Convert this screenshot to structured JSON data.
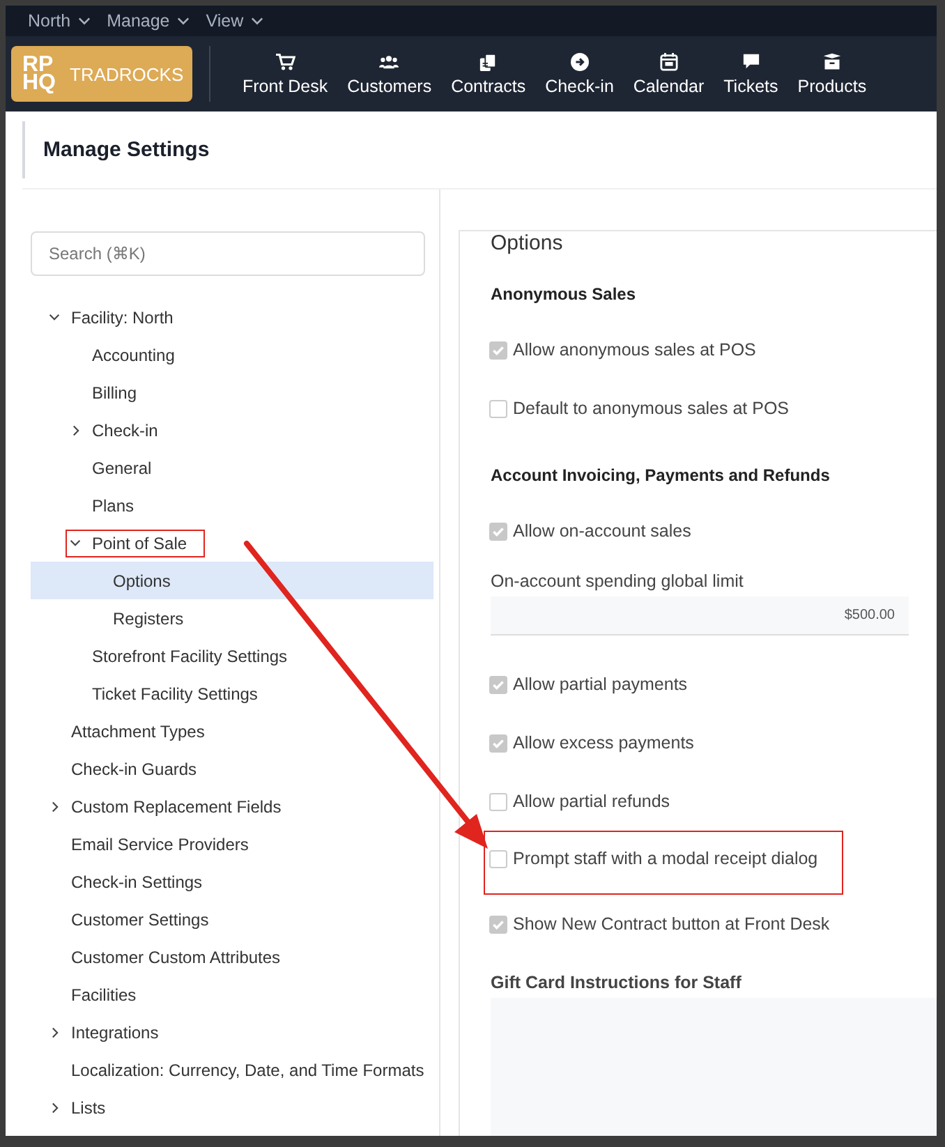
{
  "menu_bar": [
    {
      "label": "North"
    },
    {
      "label": "Manage"
    },
    {
      "label": "View"
    }
  ],
  "brand": {
    "mark_top": "RP",
    "mark_bottom": "HQ",
    "name": "TRADROCKS"
  },
  "nav": [
    {
      "label": "Front Desk"
    },
    {
      "label": "Customers"
    },
    {
      "label": "Contracts"
    },
    {
      "label": "Check-in"
    },
    {
      "label": "Calendar"
    },
    {
      "label": "Tickets"
    },
    {
      "label": "Products"
    }
  ],
  "page_title": "Manage Settings",
  "search": {
    "placeholder": "Search (⌘K)"
  },
  "tree": [
    {
      "label": "Facility: North",
      "expanded": true,
      "selected": false,
      "children": [
        {
          "label": "Accounting",
          "selected": false
        },
        {
          "label": "Billing",
          "selected": false
        },
        {
          "label": "Check-in",
          "expanded": false,
          "selected": false
        },
        {
          "label": "General",
          "selected": false
        },
        {
          "label": "Plans",
          "selected": false
        },
        {
          "label": "Point of Sale",
          "expanded": true,
          "selected": false,
          "highlighted": true,
          "children": [
            {
              "label": "Options",
              "selected": true
            },
            {
              "label": "Registers",
              "selected": false
            }
          ]
        },
        {
          "label": "Storefront Facility Settings",
          "selected": false
        },
        {
          "label": "Ticket Facility Settings",
          "selected": false
        }
      ]
    },
    {
      "label": "Attachment Types",
      "selected": false
    },
    {
      "label": "Check-in Guards",
      "selected": false
    },
    {
      "label": "Custom Replacement Fields",
      "expanded": false,
      "selected": false
    },
    {
      "label": "Email Service Providers",
      "selected": false
    },
    {
      "label": "Check-in Settings",
      "selected": false
    },
    {
      "label": "Customer Settings",
      "selected": false
    },
    {
      "label": "Customer Custom Attributes",
      "selected": false
    },
    {
      "label": "Facilities",
      "selected": false
    },
    {
      "label": "Integrations",
      "expanded": false,
      "selected": false
    },
    {
      "label": "Localization: Currency, Date, and Time Formats",
      "selected": false
    },
    {
      "label": "Lists",
      "expanded": false,
      "selected": false
    }
  ],
  "options": {
    "legend": "Options",
    "items": [
      {
        "kind": "heading",
        "label": "Anonymous Sales"
      },
      {
        "kind": "checkbox",
        "label": "Allow anonymous sales at POS",
        "checked": true
      },
      {
        "kind": "checkbox",
        "label": "Default to anonymous sales at POS",
        "checked": false
      },
      {
        "kind": "heading",
        "label": "Account Invoicing, Payments and Refunds"
      },
      {
        "kind": "checkbox",
        "label": "Allow on-account sales",
        "checked": true
      },
      {
        "kind": "money",
        "label": "On-account spending global limit",
        "value": "$500.00"
      },
      {
        "kind": "checkbox",
        "label": "Allow partial payments",
        "checked": true
      },
      {
        "kind": "checkbox",
        "label": "Allow excess payments",
        "checked": true
      },
      {
        "kind": "checkbox",
        "label": "Allow partial refunds",
        "checked": false
      },
      {
        "kind": "checkbox",
        "label": "Prompt staff with a modal receipt dialog",
        "checked": false,
        "highlighted": true
      },
      {
        "kind": "checkbox",
        "label": "Show New Contract button at Front Desk",
        "checked": true
      },
      {
        "kind": "textarea",
        "label": "Gift Card Instructions for Staff"
      }
    ]
  }
}
